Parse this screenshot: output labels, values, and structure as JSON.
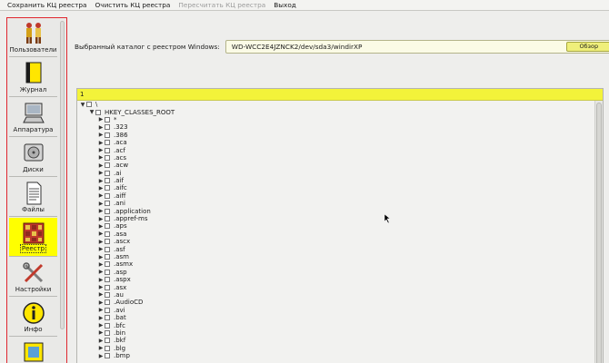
{
  "menu": {
    "items": [
      {
        "label": "Сохранить КЦ реестра",
        "enabled": true
      },
      {
        "label": "Очистить КЦ реестра",
        "enabled": true
      },
      {
        "label": "Пересчитать КЦ реестра",
        "enabled": false
      },
      {
        "label": "Выход",
        "enabled": true
      }
    ]
  },
  "sidebar": {
    "items": [
      {
        "label": "Пользователи",
        "icon": "users-icon",
        "active": false
      },
      {
        "label": "Журнал",
        "icon": "journal-icon",
        "active": false
      },
      {
        "label": "Аппаратура",
        "icon": "hardware-icon",
        "active": false
      },
      {
        "label": "Диски",
        "icon": "disk-icon",
        "active": false
      },
      {
        "label": "Файлы",
        "icon": "file-icon",
        "active": false
      },
      {
        "label": "Реестр",
        "icon": "registry-icon",
        "active": true
      },
      {
        "label": "Настройки",
        "icon": "settings-icon",
        "active": false
      },
      {
        "label": "Инфо",
        "icon": "info-icon",
        "active": false
      }
    ]
  },
  "catalog": {
    "label": "Выбранный каталог с реестром Windows:",
    "value": "WD-WCC2E4JZNCK2/dev/sda3/windirXP",
    "browse_label": "Обзор"
  },
  "tree": {
    "header": "1",
    "root_label": "\\",
    "hive_label": "HKEY_CLASSES_ROOT",
    "entries": [
      "*",
      ".323",
      ".386",
      ".aca",
      ".acf",
      ".acs",
      ".acw",
      ".ai",
      ".aif",
      ".aifc",
      ".aiff",
      ".ani",
      ".application",
      ".appref-ms",
      ".aps",
      ".asa",
      ".ascx",
      ".asf",
      ".asm",
      ".asmx",
      ".asp",
      ".aspx",
      ".asx",
      ".au",
      ".AudioCD",
      ".avi",
      ".bat",
      ".bfc",
      ".bin",
      ".bkf",
      ".blg",
      ".bmp"
    ]
  },
  "colors": {
    "active_bg": "#ffff00",
    "sidebar_border": "#e0272f",
    "header_bg": "#f3f33a"
  }
}
